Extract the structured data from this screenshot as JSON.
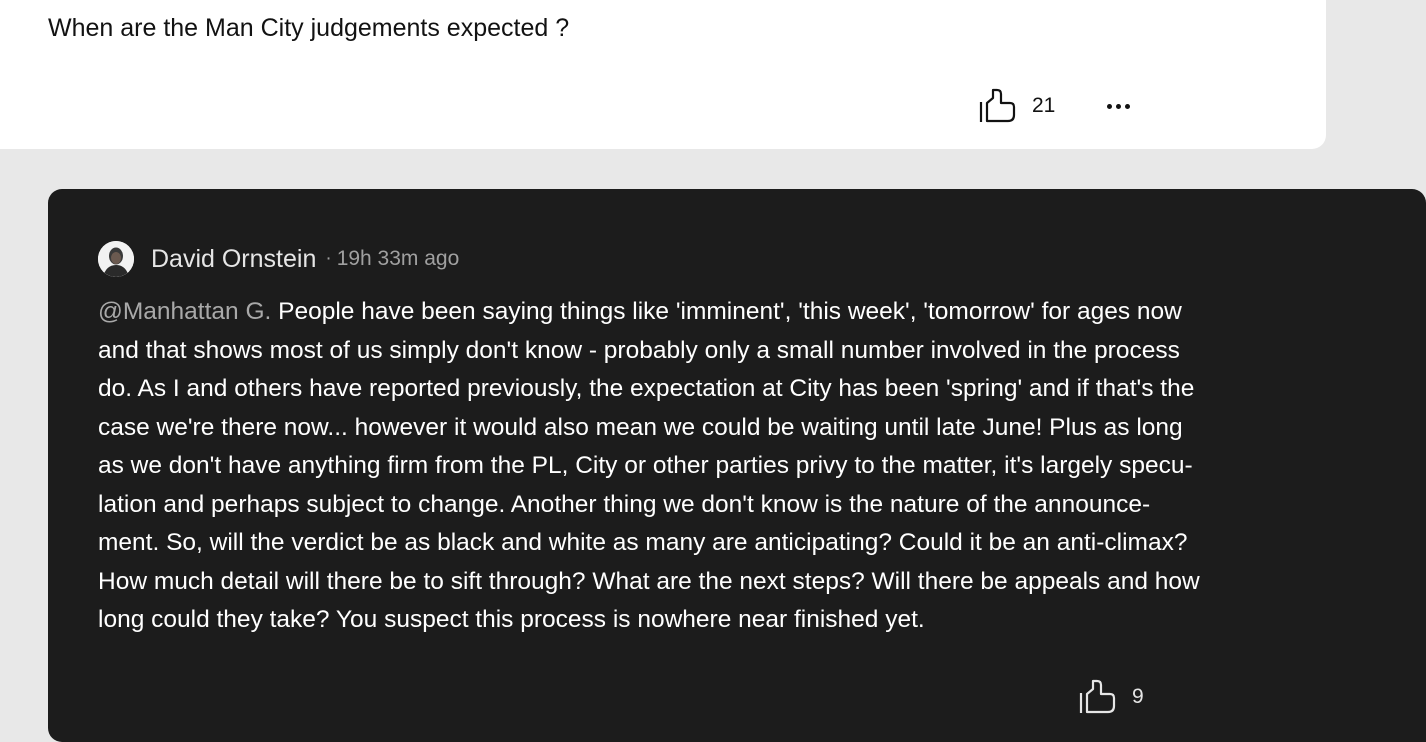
{
  "question": {
    "text": "When are the Man City judgements expected ?",
    "like_count": "21",
    "icons": {
      "like": "thumbs-up-icon",
      "more": "more-options-icon"
    }
  },
  "reply": {
    "author": "David Ornstein",
    "separator": "·",
    "timestamp": "19h 33m ago",
    "mention": "@Manhattan G.",
    "body_lines": [
      " People have been saying things like 'imminent', 'this week', 'tomorrow' for ages now",
      "and that shows most of us simply don't know - probably only a small number involved in the process",
      "do. As I and others have reported previously, the expectation at City has been 'spring' and if that's the",
      "case we're there now... however it would also mean we could be waiting until late June! Plus as long",
      "as we don't have anything firm from the PL, City or other parties privy to the matter, it's largely specu-",
      "lation and perhaps subject to change. Another thing we don't know is the nature of the announce-",
      "ment. So, will the verdict be as black and white as many are anticipating? Could it be an anti-climax?",
      "How much detail will there be to sift through? What are the next steps? Will there be appeals and how",
      "long could they take? You suspect this process is nowhere near finished yet."
    ],
    "like_count": "9",
    "icons": {
      "avatar": "author-avatar",
      "like": "thumbs-up-icon"
    }
  },
  "colors": {
    "page_background": "#e8e8e8",
    "question_card": "#ffffff",
    "reply_card": "#1c1c1c",
    "muted_text": "#a0a0a0"
  }
}
